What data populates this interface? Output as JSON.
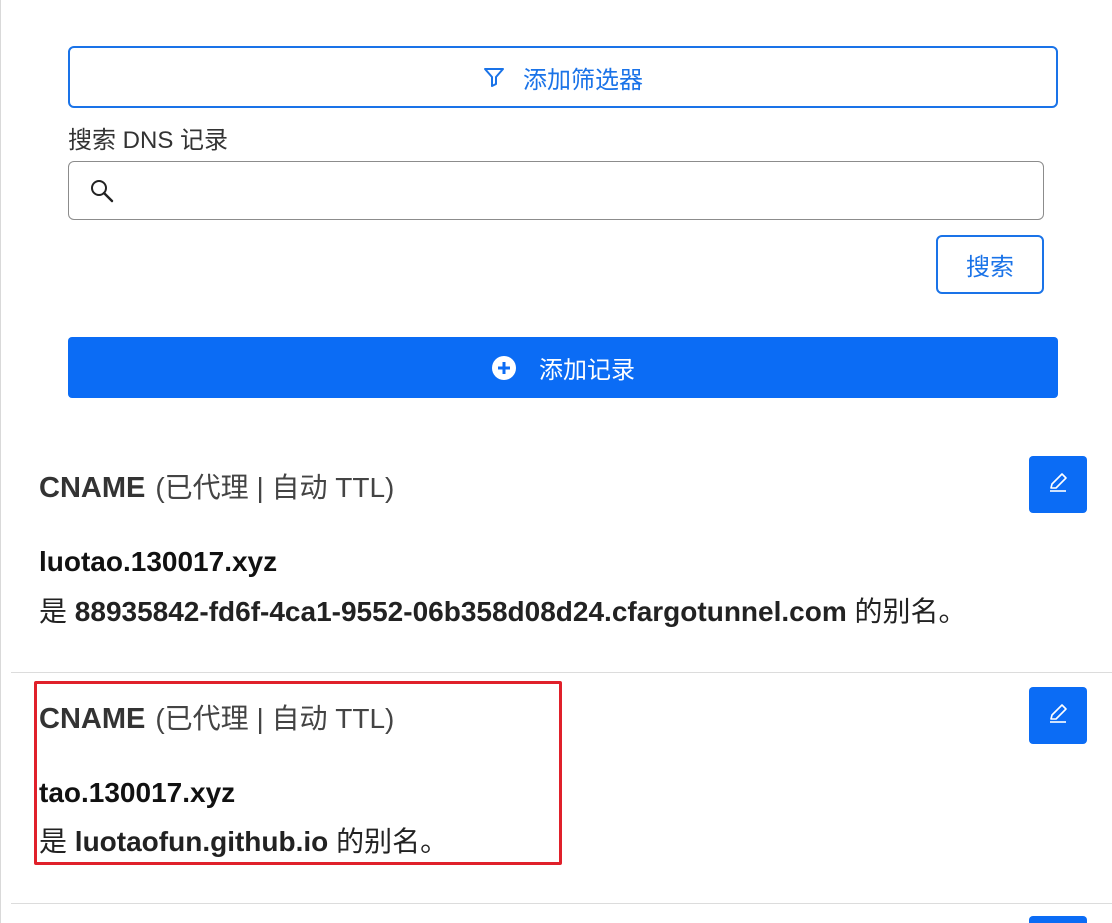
{
  "filter": {
    "label": "添加筛选器",
    "icon": "filter-icon"
  },
  "search": {
    "label": "搜索 DNS 记录",
    "value": "",
    "placeholder": "",
    "button_label": "搜索",
    "icon": "search-icon"
  },
  "add_record": {
    "label": "添加记录",
    "icon": "plus-circle-icon"
  },
  "records": [
    {
      "type": "CNAME",
      "meta": "(已代理 | 自动 TTL)",
      "name": "luotao.130017.xyz",
      "alias_prefix": "是",
      "target": "88935842-fd6f-4ca1-9552-06b358d08d24.cfargotunnel.com",
      "alias_suffix": "的别名。"
    },
    {
      "type": "CNAME",
      "meta": "(已代理 | 自动 TTL)",
      "name": "tao.130017.xyz",
      "alias_prefix": "是",
      "target": "luotaofun.github.io",
      "alias_suffix": "的别名。"
    }
  ],
  "colors": {
    "accent": "#0b6cf5",
    "highlight": "#e0202a"
  }
}
